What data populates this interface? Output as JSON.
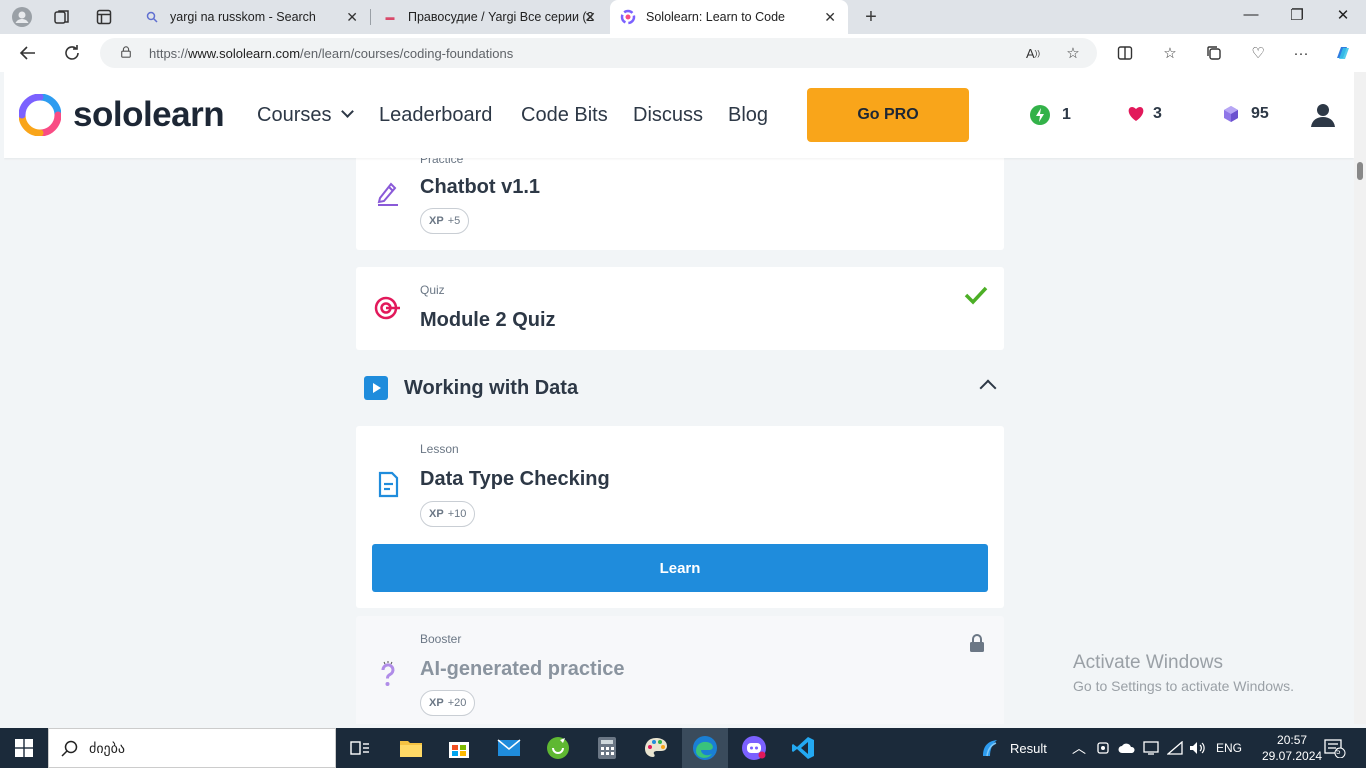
{
  "browser": {
    "tabs": [
      {
        "title": "yargi na russkom - Search",
        "active": false
      },
      {
        "title": "Правосудие / Yargi Все серии (2",
        "active": false
      },
      {
        "title": "Sololearn: Learn to Code",
        "active": true
      }
    ],
    "url_prefix": "https://",
    "url_host": "www.sololearn.com",
    "url_path": "/en/learn/courses/coding-foundations"
  },
  "header": {
    "brand": "sololearn",
    "nav": {
      "courses": "Courses",
      "leaderboard": "Leaderboard",
      "code_bits": "Code Bits",
      "discuss": "Discuss",
      "blog": "Blog"
    },
    "go_pro": "Go PRO",
    "streak": "1",
    "hearts": "3",
    "bits": "95"
  },
  "content": {
    "chatbot": {
      "type": "Practice",
      "title": "Chatbot v1.1",
      "xp_label": "XP",
      "xp": "+5"
    },
    "quiz": {
      "type": "Quiz",
      "title": "Module 2 Quiz",
      "completed": true
    },
    "module": {
      "title": "Working with Data"
    },
    "lesson": {
      "type": "Lesson",
      "title": "Data Type Checking",
      "xp_label": "XP",
      "xp": "+10",
      "button": "Learn"
    },
    "booster": {
      "type": "Booster",
      "title": "AI-generated practice",
      "xp_label": "XP",
      "xp": "+20",
      "locked": true
    }
  },
  "watermark": {
    "line1": "Activate Windows",
    "line2": "Go to Settings to activate Windows."
  },
  "taskbar": {
    "search_text": "ძიება",
    "weather": "Result",
    "language": "ENG",
    "time": "20:57",
    "date": "29.07.2024",
    "notifications": "5"
  },
  "colors": {
    "accent_blue": "#1f8cdc",
    "pro_orange": "#f9a51a",
    "check_green": "#4caf26",
    "heart": "#e2195b"
  }
}
